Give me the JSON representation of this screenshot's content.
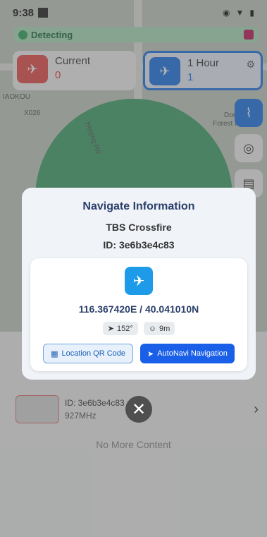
{
  "status_bar": {
    "time": "9:38"
  },
  "detect_bar": {
    "label": "Detecting"
  },
  "top_cards": {
    "current": {
      "label": "Current",
      "value": "0"
    },
    "hour": {
      "label": "1 Hour",
      "value": "1"
    }
  },
  "map": {
    "labels": [
      "IAOKOU",
      "X026",
      "Heqing Rd",
      "Dongxi",
      "Forest Park"
    ]
  },
  "list": {
    "row": {
      "id": "ID: 3e6b3e4c83",
      "freq": "927MHz"
    },
    "no_more": "No More Content"
  },
  "modal": {
    "title": "Navigate Information",
    "device": "TBS Crossfire",
    "id": "ID: 3e6b3e4c83",
    "coords": "116.367420E / 40.041010N",
    "heading": "152°",
    "distance": "9m",
    "qr_button": "Location QR Code",
    "nav_button": "AutoNavi Navigation"
  },
  "colors": {
    "accent": "#1a73e8",
    "alert": "#e84b4b",
    "green": "#2ca45a"
  }
}
